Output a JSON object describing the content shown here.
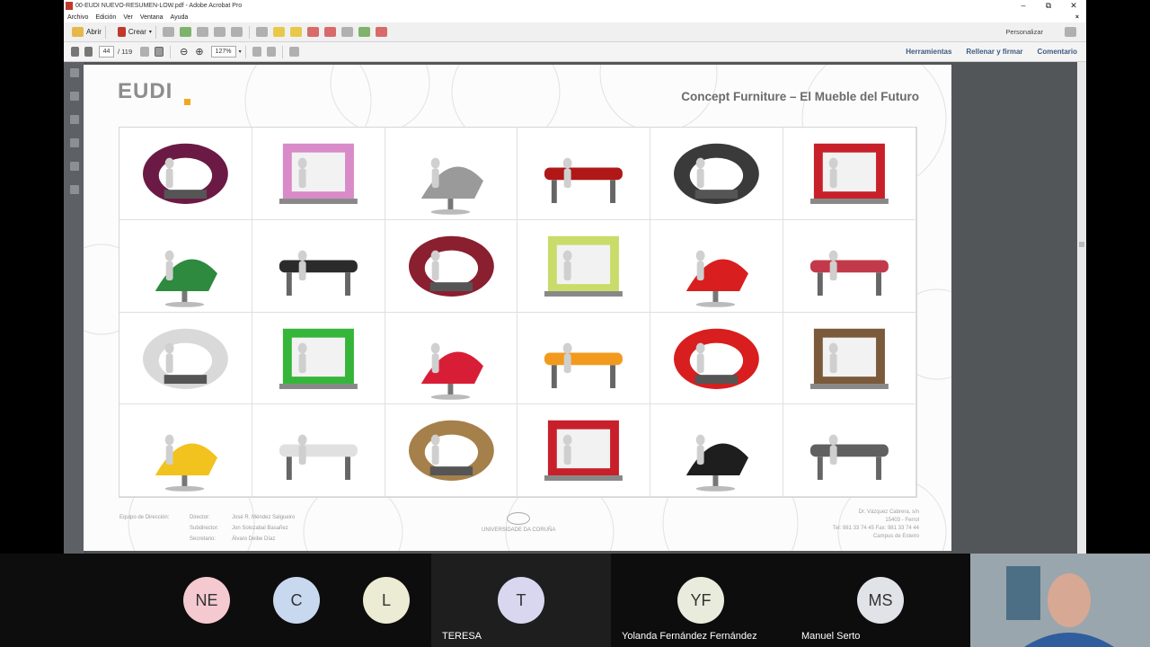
{
  "window": {
    "title": "00-EUDI NUEVO-RESUMEN-LOW.pdf - Adobe Acrobat Pro",
    "minimize": "–",
    "maximize": "⧉",
    "close": "✕"
  },
  "menu": [
    "Archivo",
    "Edición",
    "Ver",
    "Ventana",
    "Ayuda"
  ],
  "menu_close": "×",
  "toolbar": {
    "open_label": "Abrir",
    "create_label": "Crear",
    "customize_label": "Personalizar"
  },
  "nav": {
    "page_current": "44",
    "page_total": "/ 119",
    "zoom": "127%",
    "tools_label": "Herramientas",
    "fill_sign_label": "Rellenar y firmar",
    "comment_label": "Comentario"
  },
  "document": {
    "logo_text": "EUDI",
    "title": "Concept Furniture – El Mueble del Futuro",
    "footer_left": {
      "heading": "Equipo de Dirección:",
      "roles": [
        "Director:",
        "Subdirector:",
        "Secretario:"
      ],
      "names": [
        "José R. Méndez Salgueiro",
        "Jon Solozabal Basañez",
        "Álvaro Deibe Díaz"
      ]
    },
    "footer_center": "UNIVERSIDADE DA CORUÑA",
    "footer_right": [
      "Dr. Vázquez Cabrera, s/n",
      "15403 - Ferrol",
      "Tel: 981 33 74 45 Fax: 981 33 74 44",
      "Campus de Esteiro"
    ],
    "furniture_colors": [
      "#6b1a45",
      "#d98ac8",
      "#9a9a9a",
      "#b01818",
      "#3a3a3a",
      "#c8202a",
      "#2d8a3e",
      "#2b2b2b",
      "#8a1f2f",
      "#c9dc6a",
      "#d81e1e",
      "#c23a4a",
      "#d9d9d9",
      "#35b53a",
      "#d81e36",
      "#f29a1e",
      "#d81e1e",
      "#7a5a3a",
      "#f2c21e",
      "#e0e0e0",
      "#a6804a",
      "#c8202a",
      "#1e1e1e",
      "#606060"
    ]
  },
  "participants": [
    {
      "initials": "NE",
      "name": "",
      "color": "#f4c9cf"
    },
    {
      "initials": "C",
      "name": "",
      "color": "#c8d8ef"
    },
    {
      "initials": "L",
      "name": "",
      "color": "#ecebd4"
    },
    {
      "initials": "T",
      "name": "TERESA",
      "color": "#d9d6ef"
    },
    {
      "initials": "YF",
      "name": "Yolanda Fernández Fernández",
      "color": "#e9ecdc"
    },
    {
      "initials": "MS",
      "name": "Manuel Serto",
      "color": "#e0e4e8"
    }
  ]
}
